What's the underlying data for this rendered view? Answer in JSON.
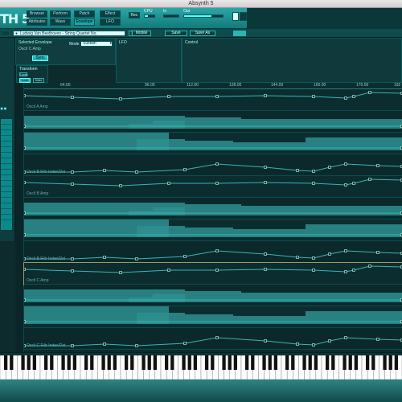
{
  "window": {
    "title": "Absynth 5"
  },
  "header": {
    "logo": "TH 5",
    "nav_row1": [
      "Browser",
      "Perform",
      "Patch",
      "Effect"
    ],
    "nav_row2": [
      "Attributes",
      "Wave",
      "Envelope",
      "LFO"
    ],
    "active_nav": "Envelope",
    "rec_label": "Rec",
    "cpu_label": "CPU",
    "in_label": "In",
    "out_label": "Out",
    "out_level": 0.7,
    "cpu_level": 0.3
  },
  "toolbar": {
    "patch_name": "Ludwig Van Beethoven - String Quartet No.",
    "mobile_label": "Mobile",
    "save_label": "Save",
    "save_as_label": "Save As"
  },
  "envelope_panel": {
    "selected_label": "Selected Envelope",
    "selected_value": "Osc/i C Amp",
    "mode_label": "Mode",
    "mode_value": "Sustain",
    "sync_label": "Sync"
  },
  "lfo_panel": {
    "title": "LFO"
  },
  "control_panel": {
    "title": "Control"
  },
  "transform": {
    "title": "Transform",
    "btn_a": "Undo",
    "btn_b": "Lock",
    "btn_c": "Slide"
  },
  "ruler": {
    "ticks": [
      "64.00",
      "96.00",
      "112.00",
      "128.00",
      "144.00",
      "160.00",
      "176.00",
      "192"
    ]
  },
  "lanes": [
    {
      "label": "Oscil A Amp"
    },
    {
      "label": ""
    },
    {
      "label": ""
    },
    {
      "label": "Oscil B Filtr Index/Dst"
    },
    {
      "label": "Oscil B Amp"
    },
    {
      "label": ""
    },
    {
      "label": ""
    },
    {
      "label": "Oscil B Filtr Index/Dst"
    },
    {
      "label": "Oscil C Amp"
    },
    {
      "label": ""
    },
    {
      "label": ""
    },
    {
      "label": "Oscil C Filtr Index/Dst"
    }
  ],
  "colors": {
    "accent": "#22a3a2",
    "curve": "#39b4b4",
    "fill": "#2e8f8f",
    "selected_outline": "#9e9c5c"
  }
}
